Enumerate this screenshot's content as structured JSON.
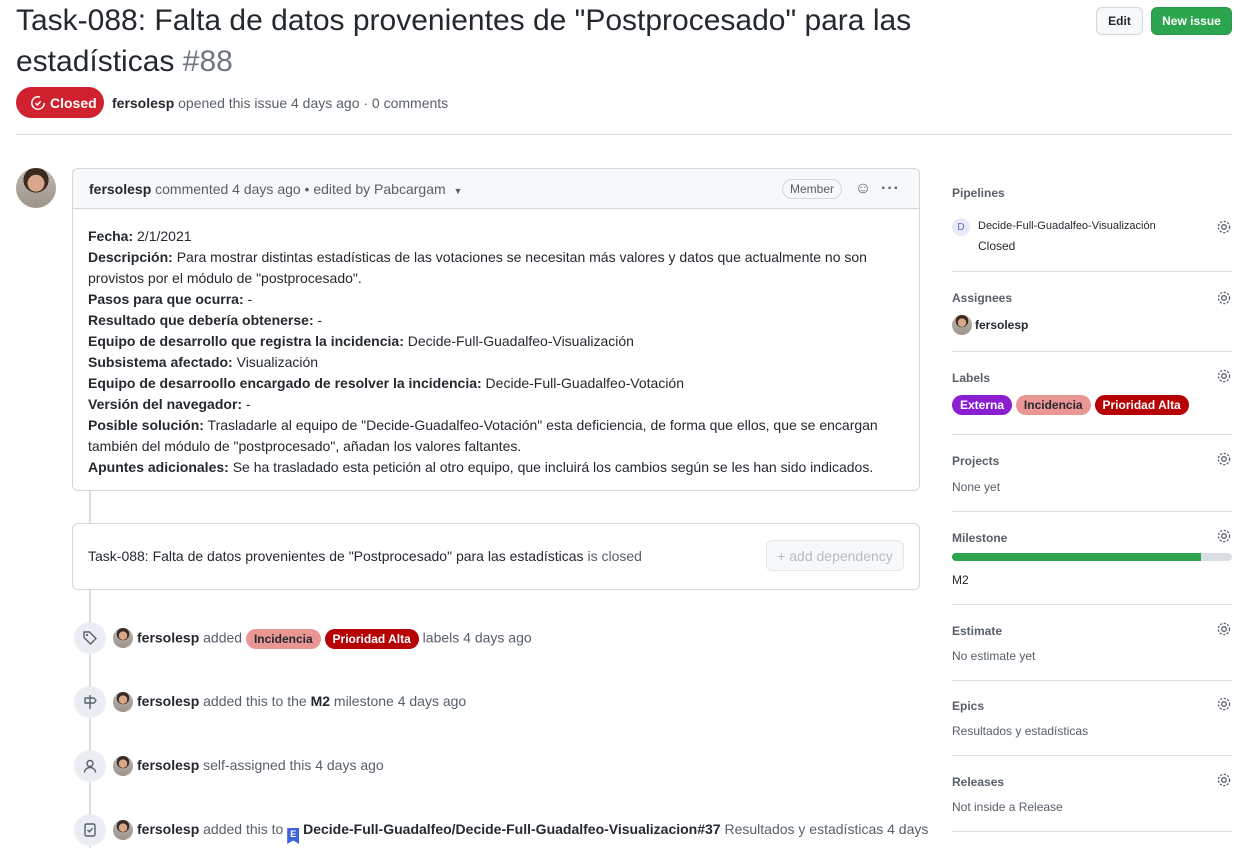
{
  "header": {
    "title": "Task-088: Falta de datos provenientes de \"Postprocesado\" para las estadísticas",
    "number": "#88",
    "edit_label": "Edit",
    "new_issue_label": "New issue",
    "state": "Closed",
    "author": "fersolesp",
    "meta_text": "opened this issue 4 days ago · 0 comments"
  },
  "comment": {
    "author": "fersolesp",
    "meta": "commented 4 days ago • edited by Pabcargam",
    "badge": "Member",
    "fields": [
      {
        "label": "Fecha:",
        "value": " 2/1/2021"
      },
      {
        "label": "Descripción:",
        "value": " Para mostrar distintas estadísticas de las votaciones se necesitan más valores y datos que actualmente no son provistos por el módulo de \"postprocesado\"."
      },
      {
        "label": "Pasos para que ocurra:",
        "value": " -"
      },
      {
        "label": "Resultado que debería obtenerse:",
        "value": " -"
      },
      {
        "label": "Equipo de desarrollo que registra la incidencia:",
        "value": " Decide-Full-Guadalfeo-Visualización"
      },
      {
        "label": "Subsistema afectado:",
        "value": " Visualización"
      },
      {
        "label": "Equipo de desarroollo encargado de resolver la incidencia:",
        "value": " Decide-Full-Guadalfeo-Votación"
      },
      {
        "label": "Versión del navegador:",
        "value": " -"
      },
      {
        "label": "Posible solución:",
        "value": " Trasladarle al equipo de \"Decide-Guadalfeo-Votación\" esta deficiencia, de forma que ellos, que se encargan también del módulo de \"postprocesado\", añadan los valores faltantes."
      },
      {
        "label": "Apuntes adicionales:",
        "value": " Se ha trasladado esta petición al otro equipo, que incluirá los cambios según se les han sido indicados."
      }
    ]
  },
  "dependency": {
    "title": "Task-088: Falta de datos provenientes de \"Postprocesado\" para las estadísticas",
    "status": "is closed",
    "button": "+ add dependency"
  },
  "timeline": {
    "labels_event": {
      "user": "fersolesp",
      "verb": "added",
      "labels": [
        "Incidencia",
        "Prioridad Alta"
      ],
      "suffix": "labels 4 days ago"
    },
    "milestone_event": {
      "user": "fersolesp",
      "pre": "added this to the",
      "milestone": "M2",
      "post": "milestone 4 days ago"
    },
    "assign_event": {
      "user": "fersolesp",
      "text": "self-assigned this 4 days ago"
    },
    "epic_event": {
      "user": "fersolesp",
      "pre": "added this to",
      "epic_badge": "E",
      "epic": "Decide-Full-Guadalfeo/Decide-Full-Guadalfeo-Visualizacion#37",
      "post": "Resultados y estadísticas 4 days"
    }
  },
  "sidebar": {
    "pipelines": {
      "heading": "Pipelines",
      "badge": "D",
      "name": "Decide-Full-Guadalfeo-Visualización",
      "status": "Closed"
    },
    "assignees": {
      "heading": "Assignees",
      "user": "fersolesp"
    },
    "labels": {
      "heading": "Labels",
      "items": [
        "Externa",
        "Incidencia",
        "Prioridad Alta"
      ]
    },
    "projects": {
      "heading": "Projects",
      "value": "None yet"
    },
    "milestone": {
      "heading": "Milestone",
      "name": "M2",
      "progress": 0.89
    },
    "estimate": {
      "heading": "Estimate",
      "value": "No estimate yet"
    },
    "epics": {
      "heading": "Epics",
      "value": "Resultados y estadísticas"
    },
    "releases": {
      "heading": "Releases",
      "value": "Not inside a Release"
    }
  },
  "colors": {
    "closed": "#cf222e",
    "new_issue": "#2da44e",
    "label_externa": "#8a1ed0",
    "label_incidencia": "#e99695",
    "label_prioridad": "#b60205",
    "milestone_bar": "#2da44e"
  }
}
